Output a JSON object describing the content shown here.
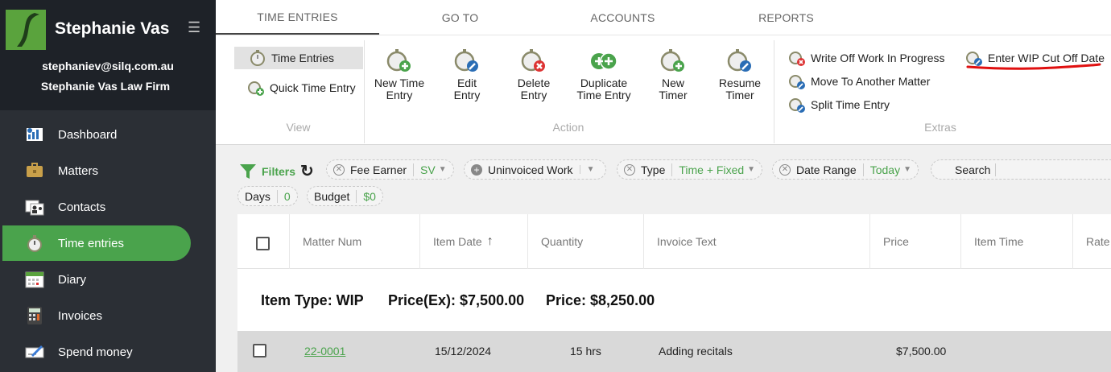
{
  "sidebar": {
    "user_name": "Stephanie Vas",
    "email": "stephaniev@silq.com.au",
    "firm": "Stephanie Vas Law Firm",
    "items": [
      {
        "label": "Dashboard",
        "icon": "dashboard-icon"
      },
      {
        "label": "Matters",
        "icon": "briefcase-icon"
      },
      {
        "label": "Contacts",
        "icon": "contacts-icon"
      },
      {
        "label": "Time entries",
        "icon": "stopwatch-icon",
        "active": true
      },
      {
        "label": "Diary",
        "icon": "calendar-icon"
      },
      {
        "label": "Invoices",
        "icon": "calculator-icon"
      },
      {
        "label": "Spend money",
        "icon": "cheque-icon"
      }
    ]
  },
  "tabs": [
    "TIME ENTRIES",
    "GO TO",
    "ACCOUNTS",
    "REPORTS"
  ],
  "ribbon": {
    "view": {
      "label": "View",
      "items": [
        "Time Entries",
        "Quick Time Entry"
      ]
    },
    "action": {
      "label": "Action",
      "items": [
        {
          "line1": "New Time",
          "line2": "Entry"
        },
        {
          "line1": "Edit",
          "line2": "Entry"
        },
        {
          "line1": "Delete",
          "line2": "Entry"
        },
        {
          "line1": "Duplicate",
          "line2": "Time Entry"
        },
        {
          "line1": "New",
          "line2": "Timer"
        },
        {
          "line1": "Resume",
          "line2": "Timer"
        }
      ]
    },
    "extras": {
      "label": "Extras",
      "items": [
        "Write Off Work In Progress",
        "Move To Another Matter",
        "Split Time Entry",
        "Enter WIP Cut Off Date"
      ]
    }
  },
  "filters": {
    "label": "Filters",
    "chips": [
      {
        "label": "Fee Earner",
        "value": "SV"
      },
      {
        "label": "Uninvoiced Work",
        "value": ""
      },
      {
        "label": "Type",
        "value": "Time + Fixed"
      },
      {
        "label": "Date Range",
        "value": "Today"
      },
      {
        "label": "Search",
        "value": ""
      },
      {
        "label": "Days",
        "value": "0"
      },
      {
        "label": "Budget",
        "value": "$0"
      }
    ]
  },
  "table": {
    "columns": [
      "Matter Num",
      "Item Date",
      "Quantity",
      "Invoice Text",
      "Price",
      "Item Time",
      "Rate"
    ],
    "sort_arrow": "↑",
    "group": {
      "type": "Item Type: WIP",
      "price_ex": "Price(Ex): $7,500.00",
      "price": "Price: $8,250.00"
    },
    "rows": [
      {
        "matter": "22-0001",
        "date": "15/12/2024",
        "quantity": "15 hrs",
        "text": "Adding recitals",
        "price": "$7,500.00"
      }
    ]
  },
  "colors": {
    "accent": "#4aa34c",
    "sidebar": "#2b2f35",
    "annotation": "#e01010"
  }
}
